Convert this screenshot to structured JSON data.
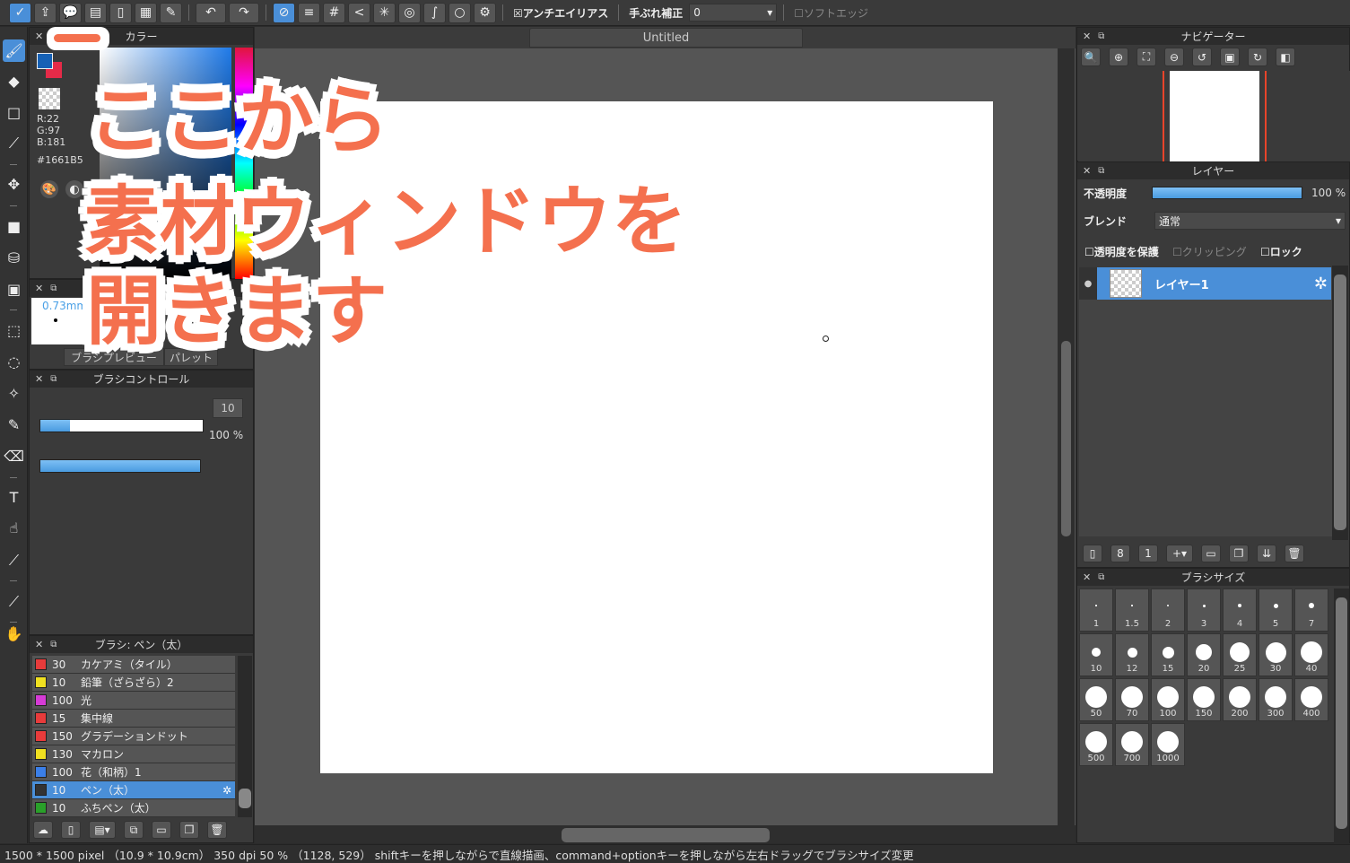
{
  "toolbar": {
    "icons": [
      "logo-icon",
      "share-icon",
      "speech-bubble-icon",
      "comment-icon",
      "document-icon",
      "layout-icon",
      "edit-icon"
    ],
    "snap_icons": [
      "snap-off-icon",
      "parallel-snap-icon",
      "grid-snap-icon",
      "perspective-snap-icon",
      "radial-snap-icon",
      "concentric-snap-icon",
      "curve-snap-icon",
      "ellipse-snap-icon",
      "settings-snap-icon"
    ],
    "antialias_label": "☒アンチエイリアス",
    "stabilizer_label": "手ぶれ補正",
    "stabilizer_value": "0",
    "soft_edge_label": "☐ソフトエッジ"
  },
  "tools": [
    "brush-tool-icon",
    "eraser-tool-icon",
    "rectangle-tool-icon",
    "dot-tool-icon",
    "move-tool-icon",
    "fill-rect-tool-icon",
    "bucket-tool-icon",
    "gradient-tool-icon",
    "select-rect-tool-icon",
    "lasso-tool-icon",
    "magic-wand-tool-icon",
    "select-pen-tool-icon",
    "select-eraser-tool-icon",
    "text-tool-icon",
    "select-layer-tool-icon",
    "eyedropper-tool-icon",
    "dropper-tool-icon",
    "hand-tool-icon"
  ],
  "color_panel": {
    "title": "カラー",
    "r": "R:22",
    "g": "G:97",
    "b": "B:181",
    "hex": "#1661B5",
    "fg_color": "#1661b5",
    "bg_color": "#e52a48"
  },
  "brush_preview": {
    "size": "0.73mm",
    "tab1": "ブラシプレビュー",
    "tab2": "パレット"
  },
  "brush_control": {
    "title": "ブラシコントロール",
    "size_value": "10",
    "size_fraction": 0.18,
    "opacity_value": "100 %",
    "opacity_fraction": 1.0
  },
  "brush_list": {
    "title": "ブラシ: ペン（太）",
    "items": [
      {
        "num": "30",
        "name": "カケアミ（タイル）",
        "color": "#e83b3b"
      },
      {
        "num": "10",
        "name": "鉛筆（ざらざら）2",
        "color": "#f0e020"
      },
      {
        "num": "100",
        "name": "光",
        "color": "#d63bd6"
      },
      {
        "num": "15",
        "name": "集中線",
        "color": "#e83b3b"
      },
      {
        "num": "150",
        "name": "グラデーションドット",
        "color": "#e83b3b"
      },
      {
        "num": "130",
        "name": "マカロン",
        "color": "#f0e020"
      },
      {
        "num": "100",
        "name": "花（和柄）1",
        "color": "#3b7fe8"
      },
      {
        "num": "10",
        "name": "ペン（太）",
        "color": "#333333"
      },
      {
        "num": "10",
        "name": "ふちペン（太）",
        "color": "#2aa02a"
      }
    ],
    "selected_index": 7
  },
  "document": {
    "tab_title": "Untitled"
  },
  "navigator": {
    "title": "ナビゲーター"
  },
  "layer_panel": {
    "title": "レイヤー",
    "opacity_label": "不透明度",
    "opacity_value": "100 %",
    "blend_label": "ブレンド",
    "blend_value": "通常",
    "protect_label": "☐透明度を保護",
    "clipping_label": "☐クリッピング",
    "lock_label": "☐ロック",
    "layer_name": "レイヤー1"
  },
  "brush_size_panel": {
    "title": "ブラシサイズ",
    "sizes": [
      "1",
      "1.5",
      "2",
      "3",
      "4",
      "5",
      "7",
      "10",
      "12",
      "15",
      "20",
      "25",
      "30",
      "40",
      "50",
      "70",
      "100",
      "150",
      "200",
      "300",
      "400",
      "500",
      "700",
      "1000"
    ]
  },
  "status": {
    "text": "1500 * 1500 pixel （10.9 * 10.9cm） 350 dpi 50 % （1128, 529） shiftキーを押しながらで直線描画、command+optionキーを押しながら左右ドラッグでブラシサイズ変更"
  },
  "overlay": {
    "line1": "ここから",
    "line2": "素材ウィンドウを",
    "line3": "開きます"
  }
}
